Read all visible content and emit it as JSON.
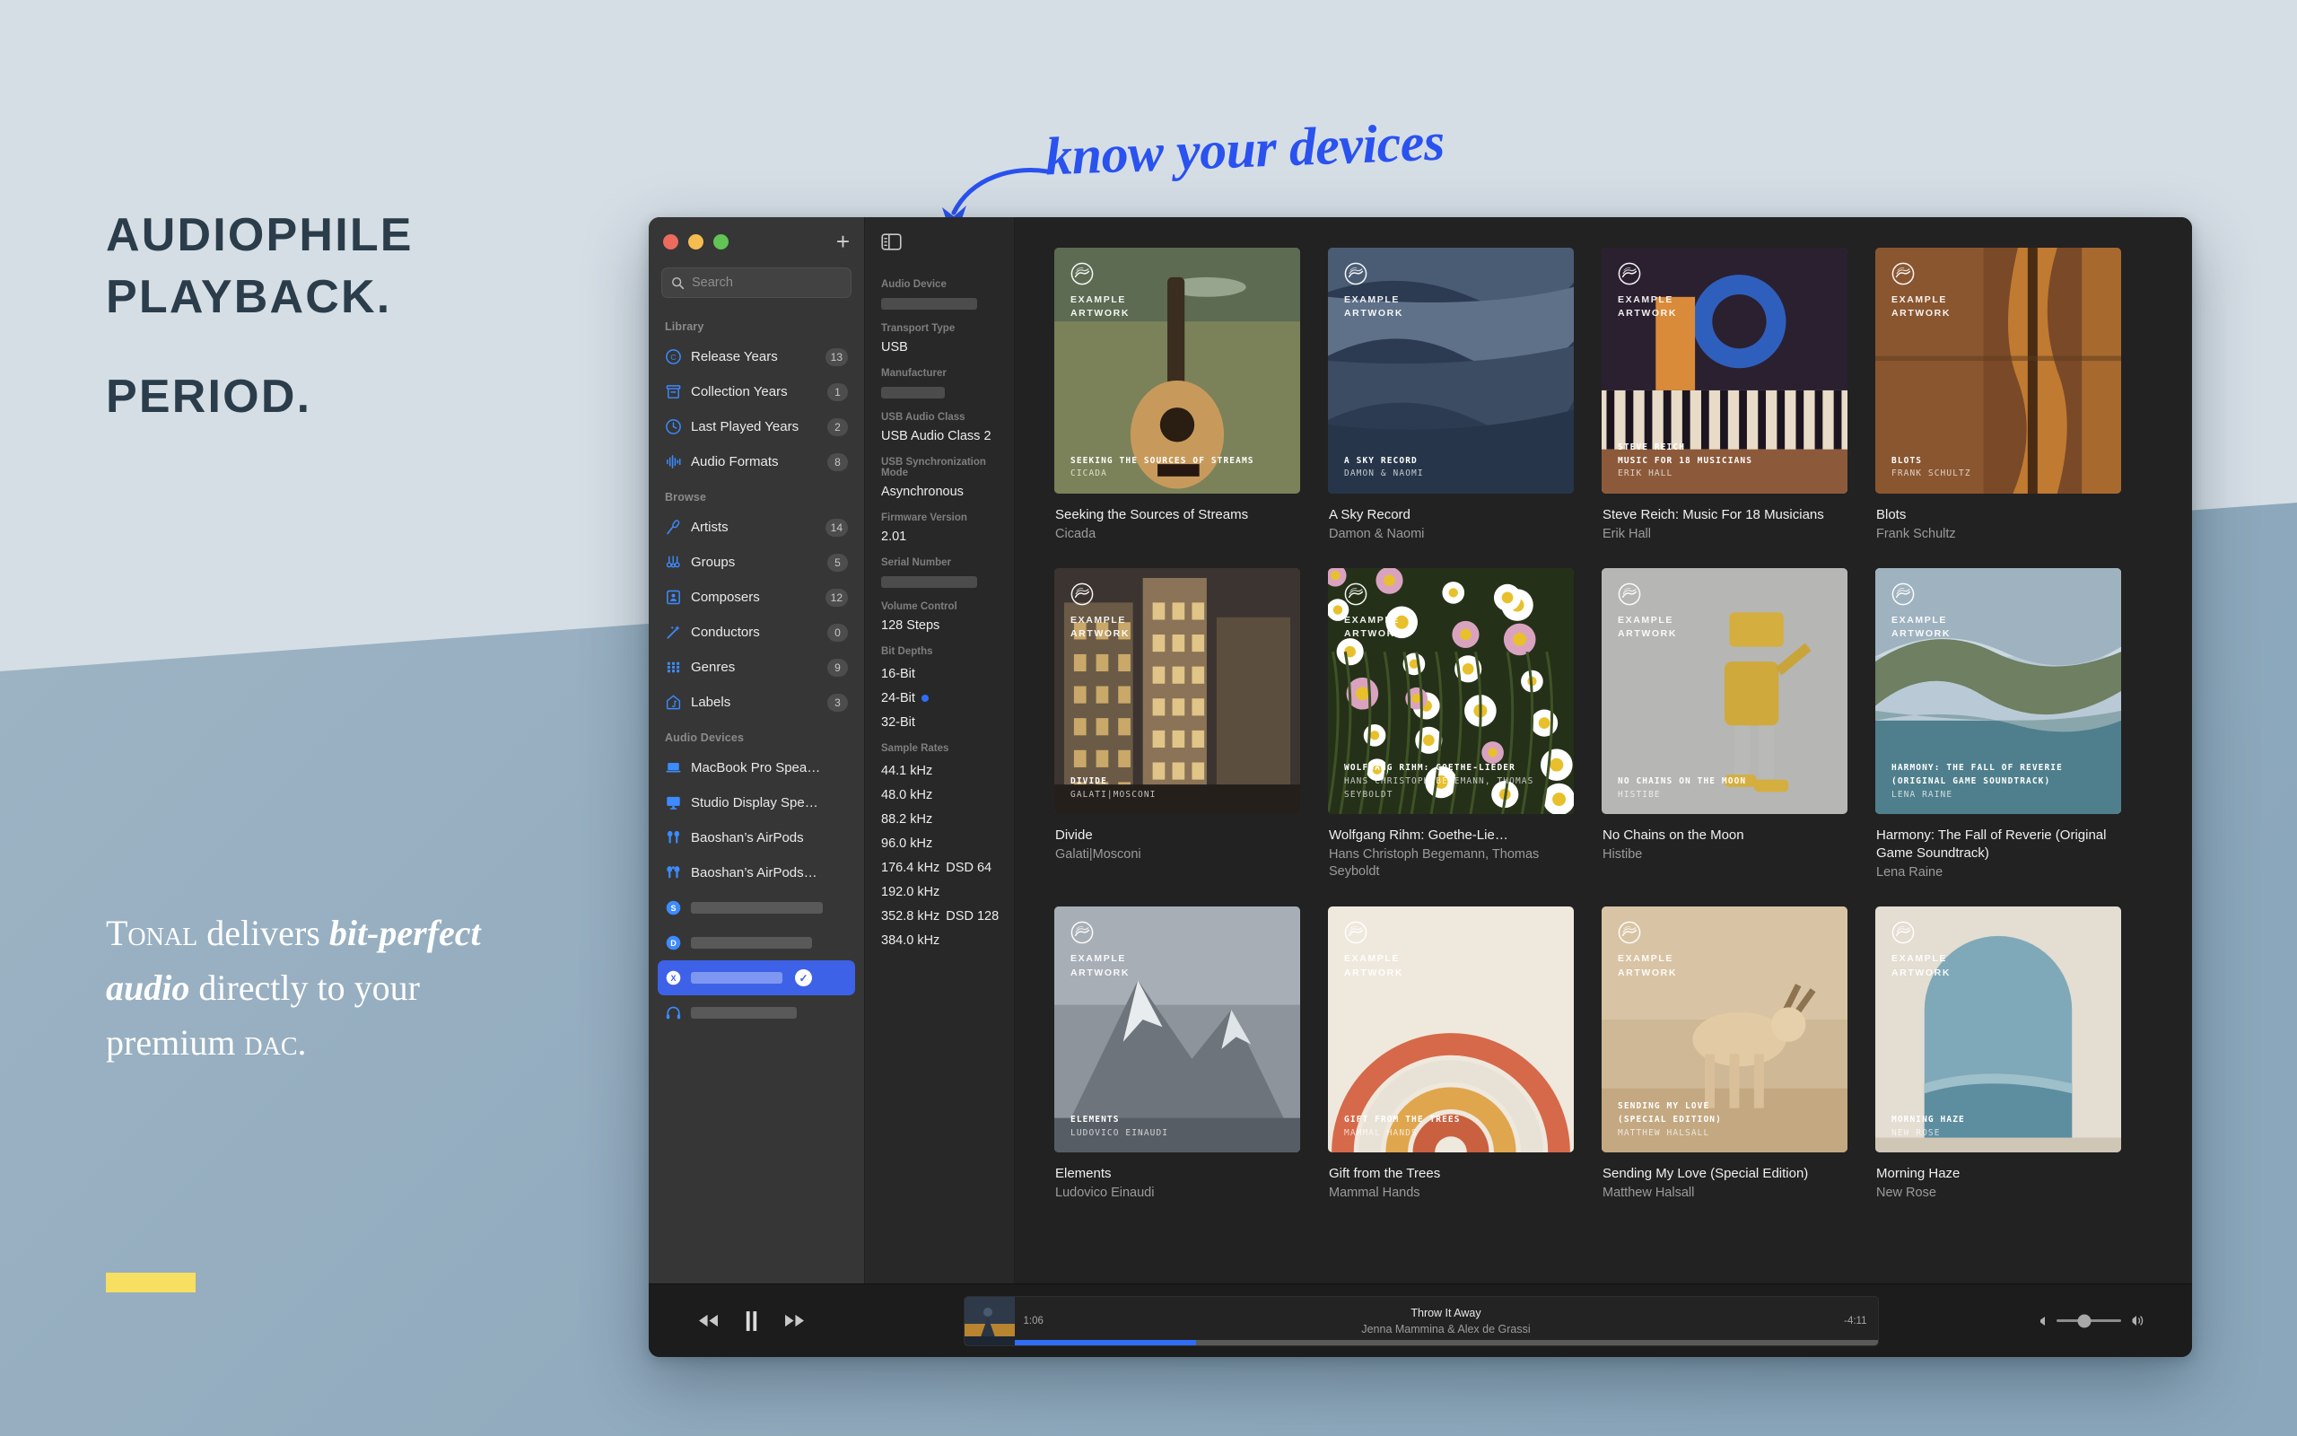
{
  "background": {
    "top_color": "#d5dee5",
    "bottom_color": "#95aec0"
  },
  "marketing": {
    "headline_line1": "Audiophile",
    "headline_line2": "Playback.",
    "headline_line3": "Period.",
    "body_part1": "Tonal",
    "body_part2": " delivers ",
    "body_italic": "bit-perfect audio",
    "body_part3": " directly to your premium ",
    "body_smallcaps": "dac",
    "body_end": ".",
    "accent_color": "#f6df61"
  },
  "annotation": {
    "text": "know your devices",
    "color": "#2a52ef"
  },
  "window": {
    "titlebar": {
      "close_label": "close",
      "minimize_label": "minimize",
      "zoom_label": "zoom",
      "new_tab_label": "+"
    },
    "search": {
      "placeholder": "Search",
      "value": ""
    },
    "sidebar": {
      "sections": [
        {
          "header": "Library",
          "items": [
            {
              "label": "Release Years",
              "count": "13",
              "icon": "copyright-icon"
            },
            {
              "label": "Collection Years",
              "count": "1",
              "icon": "archive-box-icon"
            },
            {
              "label": "Last Played Years",
              "count": "2",
              "icon": "clock-icon"
            },
            {
              "label": "Audio Formats",
              "count": "8",
              "icon": "waveform-icon"
            }
          ]
        },
        {
          "header": "Browse",
          "items": [
            {
              "label": "Artists",
              "count": "14",
              "icon": "microphone-icon"
            },
            {
              "label": "Groups",
              "count": "5",
              "icon": "group-icon"
            },
            {
              "label": "Composers",
              "count": "12",
              "icon": "person-frame-icon"
            },
            {
              "label": "Conductors",
              "count": "0",
              "icon": "wand-icon"
            },
            {
              "label": "Genres",
              "count": "9",
              "icon": "grid-dots-icon"
            },
            {
              "label": "Labels",
              "count": "3",
              "icon": "house-music-icon"
            }
          ]
        },
        {
          "header": "Audio Devices",
          "items": [
            {
              "label": "MacBook Pro Spea…",
              "count": "",
              "icon": "laptop-icon"
            },
            {
              "label": "Studio Display Spe…",
              "count": "",
              "icon": "display-icon"
            },
            {
              "label": "Baoshan’s AirPods",
              "count": "",
              "icon": "airpods-icon"
            },
            {
              "label": "Baoshan’s AirPods…",
              "count": "",
              "icon": "airpods-pro-icon"
            },
            {
              "label": "",
              "count": "",
              "icon": "s-badge-icon",
              "redacted": true,
              "bar_width": "72%"
            },
            {
              "label": "",
              "count": "",
              "icon": "d-badge-icon",
              "redacted": true,
              "bar_width": "66%"
            },
            {
              "label": "",
              "count": "",
              "icon": "x-badge-icon",
              "redacted": true,
              "bar_width": "50%",
              "selected": true,
              "checked": "✓"
            },
            {
              "label": "",
              "count": "",
              "icon": "headphones-icon",
              "redacted": true,
              "bar_width": "58%"
            }
          ]
        }
      ]
    },
    "info_panel": {
      "toggle_icon": "sidebar-toggle-icon",
      "fields": [
        {
          "label": "Audio Device",
          "value": "",
          "redacted": true,
          "bar_width": "72%"
        },
        {
          "label": "Transport Type",
          "value": "USB"
        },
        {
          "label": "Manufacturer",
          "value": "",
          "redacted": true,
          "bar_width": "48%"
        },
        {
          "label": "USB Audio Class",
          "value": "USB Audio Class 2"
        },
        {
          "label": "USB Synchronization Mode",
          "value": "Asynchronous"
        },
        {
          "label": "Firmware Version",
          "value": "2.01"
        },
        {
          "label": "Serial Number",
          "value": "",
          "redacted": true,
          "bar_width": "72%"
        },
        {
          "label": "Volume Control",
          "value": "128 Steps"
        }
      ],
      "bit_depths": {
        "header": "Bit Depths",
        "items": [
          {
            "label": "16-Bit",
            "active": false
          },
          {
            "label": "24-Bit",
            "active": true
          },
          {
            "label": "32-Bit",
            "active": false
          }
        ]
      },
      "sample_rates": {
        "header": "Sample Rates",
        "items": [
          {
            "label": "44.1 kHz",
            "dsd": ""
          },
          {
            "label": "48.0 kHz",
            "dsd": ""
          },
          {
            "label": "88.2 kHz",
            "dsd": ""
          },
          {
            "label": "96.0 kHz",
            "dsd": ""
          },
          {
            "label": "176.4 kHz",
            "dsd": "DSD 64"
          },
          {
            "label": "192.0 kHz",
            "dsd": ""
          },
          {
            "label": "352.8 kHz",
            "dsd": "DSD 128"
          },
          {
            "label": "384.0 kHz",
            "dsd": ""
          }
        ]
      }
    },
    "albums": [
      {
        "title": "Seeking the Sources of Streams",
        "artist": "Cicada",
        "art_title": "SEEKING THE SOURCES OF STREAMS",
        "art_artist": "CICADA",
        "watermark": "EXAMPLE\nARTWORK",
        "art_theme": "guitar-field"
      },
      {
        "title": "A Sky Record",
        "artist": "Damon & Naomi",
        "art_title": "A SKY RECORD",
        "art_artist": "DAMON & NAOMI",
        "watermark": "EXAMPLE\nARTWORK",
        "art_theme": "blue-waves"
      },
      {
        "title": "Steve Reich: Music For 18 Musicians",
        "artist": "Erik Hall",
        "art_title": "STEVE REICH\nMUSIC FOR 18 MUSICIANS",
        "art_artist": "ERIK HALL",
        "watermark": "EXAMPLE\nARTWORK",
        "art_theme": "piano-figure"
      },
      {
        "title": "Blots",
        "artist": "Frank Schultz",
        "art_title": "BLOTS",
        "art_artist": "FRANK SCHULTZ",
        "watermark": "EXAMPLE\nARTWORK",
        "art_theme": "cello-wood"
      },
      {
        "title": "Divide",
        "artist": "Galati|Mosconi",
        "art_title": "DIVIDE",
        "art_artist": "GALATI|MOSCONI",
        "watermark": "EXAMPLE\nARTWORK",
        "art_theme": "city-arch"
      },
      {
        "title": "Wolfgang Rihm: Goethe-Lie…",
        "artist": "Hans Christoph Begemann, Thomas Seyboldt",
        "art_title": "WOLFGANG RIHM: GOETHE-LIEDER",
        "art_artist": "HANS CHRISTOPH BEGEMANN, THOMAS SEYBOLDT",
        "watermark": "EXAMPLE\nARTWORK",
        "art_theme": "daisies"
      },
      {
        "title": "No Chains on the Moon",
        "artist": "Histibe",
        "art_title": "NO CHAINS ON THE MOON",
        "art_artist": "HISTIBE",
        "watermark": "EXAMPLE\nARTWORK",
        "art_theme": "robot-grey"
      },
      {
        "title": "Harmony: The Fall of Reverie (Original Game Soundtrack)",
        "artist": "Lena Raine",
        "art_title": "HARMONY: THE FALL OF REVERIE\n(ORIGINAL GAME SOUNDTRACK)",
        "art_artist": "LENA RAINE",
        "watermark": "EXAMPLE\nARTWORK",
        "art_theme": "coast-cliff"
      },
      {
        "title": "Elements",
        "artist": "Ludovico Einaudi",
        "art_title": "ELEMENTS",
        "art_artist": "LUDOVICO EINAUDI",
        "watermark": "EXAMPLE\nARTWORK",
        "art_theme": "mountain-snow"
      },
      {
        "title": "Gift from the Trees",
        "artist": "Mammal Hands",
        "art_title": "GIFT FROM THE TREES",
        "art_artist": "MAMMAL HANDS",
        "watermark": "EXAMPLE\nARTWORK",
        "art_theme": "rainbow-arcs"
      },
      {
        "title": "Sending My Love (Special Edition)",
        "artist": "Matthew Halsall",
        "art_title": "SENDING MY LOVE\n(SPECIAL EDITION)",
        "art_artist": "MATTHEW HALSALL",
        "watermark": "EXAMPLE\nARTWORK",
        "art_theme": "antelope-desert"
      },
      {
        "title": "Morning Haze",
        "artist": "New Rose",
        "art_title": "MORNING HAZE",
        "art_artist": "NEW ROSE",
        "watermark": "EXAMPLE\nARTWORK",
        "art_theme": "arch-sea"
      }
    ],
    "player": {
      "prev_label": "previous",
      "play_pause_label": "pause",
      "next_label": "next",
      "track_title": "Throw It Away",
      "track_artist": "Jenna Mammina & Alex de Grassi",
      "elapsed": "1:06",
      "remaining": "-4:11",
      "progress_percent": 21,
      "progress_color": "#2f6df6",
      "volume_percent": 43
    }
  }
}
